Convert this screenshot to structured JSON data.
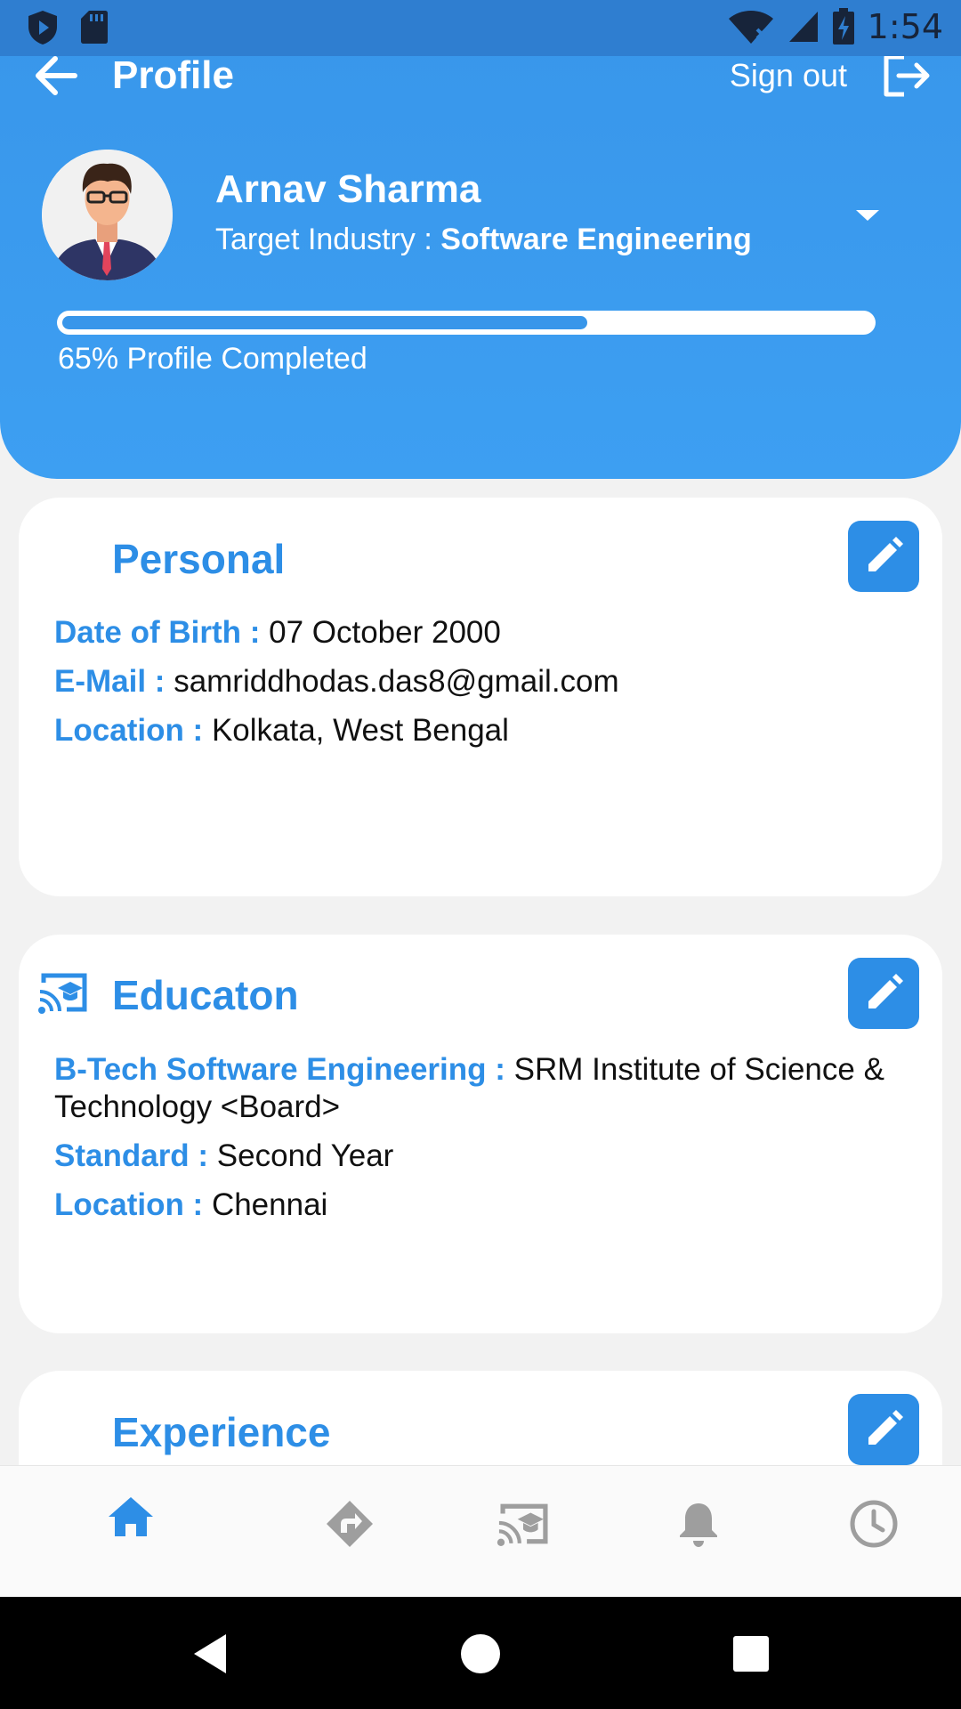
{
  "status_bar": {
    "time": "1:54",
    "icons": [
      "shield-icon",
      "sd-card-icon",
      "wifi-off-icon",
      "signal-icon",
      "battery-charging-icon"
    ]
  },
  "header": {
    "title": "Profile",
    "sign_out_label": "Sign out",
    "user_name": "Arnav Sharma",
    "industry_label": "Target Industry : ",
    "industry_value": "Software Engineering",
    "progress_fraction": 0.65,
    "progress_text": "65% Profile Completed"
  },
  "personal": {
    "title": "Personal",
    "dob_label": "Date of Birth : ",
    "dob_value": "07 October 2000",
    "email_label": "E-Mail : ",
    "email_value": "samriddhodas.das8@gmail.com",
    "location_label": "Location : ",
    "location_value": "Kolkata, West Bengal"
  },
  "education": {
    "title": "Educaton",
    "degree_label": "B-Tech Software Engineering : ",
    "degree_value": "SRM Institute of Science & Technology <Board>",
    "standard_label": "Standard : ",
    "standard_value": "Second Year",
    "location_label": "Location : ",
    "location_value": "Chennai"
  },
  "experience": {
    "title": "Experience"
  },
  "bottom_nav": {
    "items": [
      "home-icon",
      "directions-icon",
      "cast-education-icon",
      "bell-icon",
      "clock-icon"
    ],
    "active": "home-icon"
  },
  "colors": {
    "accent": "#2d8ee6",
    "header": "#3896ea",
    "inactive_icon": "#9e9e9e"
  }
}
